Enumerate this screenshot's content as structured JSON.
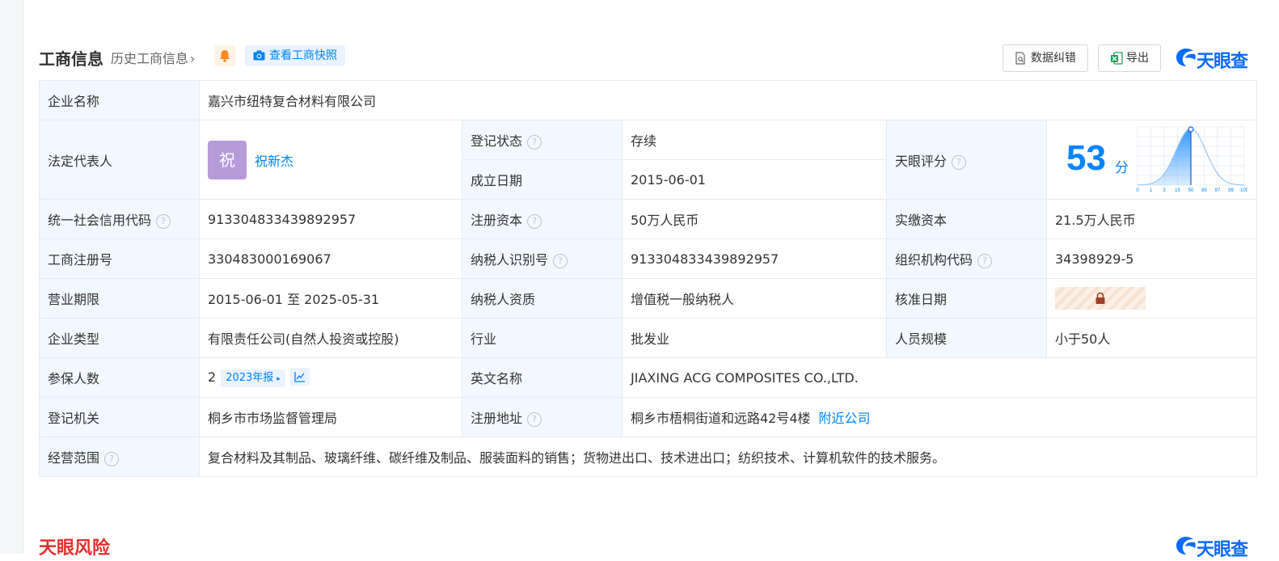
{
  "header": {
    "title": "工商信息",
    "history_link": "历史工商信息",
    "snapshot_label": "查看工商快照",
    "correct_label": "数据纠错",
    "export_label": "导出",
    "brand": "天眼查"
  },
  "company": {
    "name_label": "企业名称",
    "name_value": "嘉兴市纽特复合材料有限公司",
    "legal_label": "法定代表人",
    "legal_avatar": "祝",
    "legal_name": "祝新杰",
    "status_label": "登记状态",
    "status_value": "存续",
    "founded_label": "成立日期",
    "founded_value": "2015-06-01",
    "score_label": "天眼评分",
    "score_value": "53",
    "score_unit": "分",
    "credit_label": "统一社会信用代码",
    "credit_value": "913304833439892957",
    "reg_capital_label": "注册资本",
    "reg_capital_value": "50万人民币",
    "paid_capital_label": "实缴资本",
    "paid_capital_value": "21.5万人民币",
    "biz_reg_label": "工商注册号",
    "biz_reg_value": "330483000169067",
    "taxpayer_id_label": "纳税人识别号",
    "taxpayer_id_value": "913304833439892957",
    "org_code_label": "组织机构代码",
    "org_code_value": "34398929-5",
    "term_label": "营业期限",
    "term_value": "2015-06-01 至 2025-05-31",
    "taxpayer_q_label": "纳税人资质",
    "taxpayer_q_value": "增值税一般纳税人",
    "approve_label": "核准日期",
    "type_label": "企业类型",
    "type_value": "有限责任公司(自然人投资或控股)",
    "industry_label": "行业",
    "industry_value": "批发业",
    "staff_label": "人员规模",
    "staff_value": "小于50人",
    "insured_label": "参保人数",
    "insured_value": "2",
    "insured_report": "2023年报",
    "en_name_label": "英文名称",
    "en_name_value": "JIAXING ACG COMPOSITES CO.,LTD.",
    "authority_label": "登记机关",
    "authority_value": "桐乡市市场监督管理局",
    "address_label": "注册地址",
    "address_value": "桐乡市梧桐街道和远路42号4楼",
    "nearby_label": "附近公司",
    "scope_label": "经营范围",
    "scope_value": "复合材料及其制品、玻璃纤维、碳纤维及制品、服装面料的销售；货物进出口、技术进出口；纺织技术、计算机软件的技术服务。"
  },
  "score_chart": {
    "ticks": [
      "0",
      "1",
      "3",
      "15",
      "50",
      "85",
      "97",
      "99",
      "100"
    ],
    "marker_tick": "50"
  },
  "risk": {
    "title": "天眼风险",
    "brand": "天眼查"
  },
  "colors": {
    "accent": "#0084ff",
    "label_bg": "#f2f8ff",
    "status_green": "#1aaa55",
    "risk_red": "#e62e2e"
  }
}
